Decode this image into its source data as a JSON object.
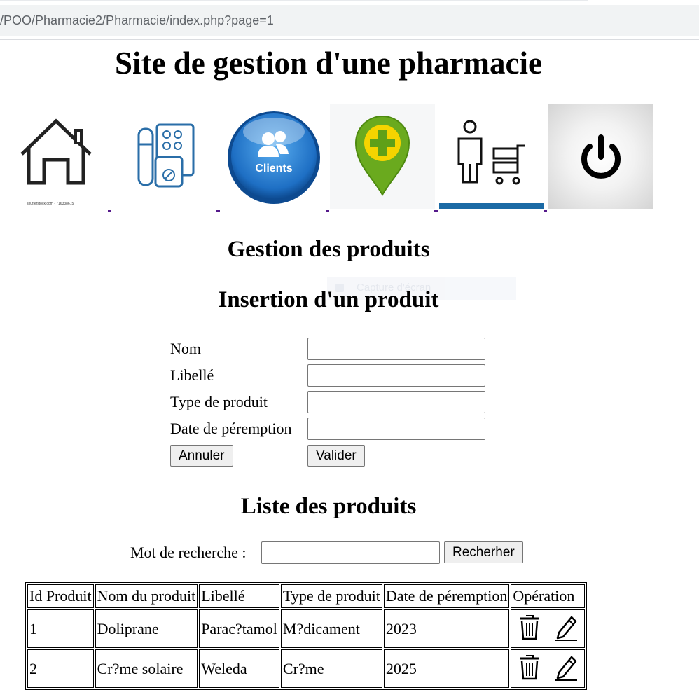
{
  "browser": {
    "url": "/POO/Pharmacie2/Pharmacie/index.php?page=1"
  },
  "site_title": "Site de gestion d'une pharmacie",
  "nav": [
    {
      "name": "home",
      "caption": "shutterstock.com · 716338615"
    },
    {
      "name": "products"
    },
    {
      "name": "clients",
      "label": "Clients"
    },
    {
      "name": "pharmacy"
    },
    {
      "name": "staff"
    },
    {
      "name": "logout"
    }
  ],
  "headings": {
    "gestion": "Gestion des produits",
    "insertion": "Insertion d'un produit",
    "liste": "Liste des produits"
  },
  "form": {
    "fields": [
      {
        "label": "Nom",
        "value": ""
      },
      {
        "label": "Libellé",
        "value": ""
      },
      {
        "label": "Type de produit",
        "value": ""
      },
      {
        "label": "Date de péremption",
        "value": ""
      }
    ],
    "cancel_label": "Annuler",
    "submit_label": "Valider"
  },
  "search": {
    "label": "Mot de recherche :",
    "value": "",
    "button_label": "Recherher"
  },
  "table": {
    "headers": [
      "Id Produit",
      "Nom du produit",
      "Libellé",
      "Type de produit",
      "Date de péremption",
      "Opération"
    ],
    "rows": [
      [
        "1",
        "Doliprane",
        "Parac?tamol",
        "M?dicament",
        "2023"
      ],
      [
        "2",
        "Cr?me solaire",
        "Weleda",
        "Cr?me",
        "2025"
      ]
    ]
  },
  "colors": {
    "clients_blue": "#1e6fc4",
    "pharmacy_green": "#6aaa1e",
    "cross_yellow": "#f5d400"
  }
}
